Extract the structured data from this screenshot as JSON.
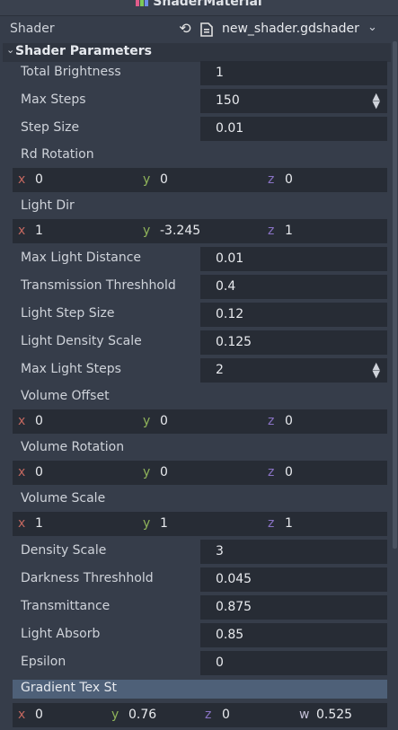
{
  "header": {
    "title": "ShaderMaterial"
  },
  "shader": {
    "label": "Shader",
    "file": "new_shader.gdshader"
  },
  "section": {
    "title": "Shader Parameters"
  },
  "params": {
    "total_brightness": {
      "label": "Total Brightness",
      "value": "1"
    },
    "max_steps": {
      "label": "Max Steps",
      "value": "150"
    },
    "step_size": {
      "label": "Step Size",
      "value": "0.01"
    },
    "rd_rotation": {
      "label": "Rd Rotation",
      "x": "0",
      "y": "0",
      "z": "0"
    },
    "light_dir": {
      "label": "Light Dir",
      "x": "1",
      "y": "-3.245",
      "z": "1"
    },
    "max_light_distance": {
      "label": "Max Light Distance",
      "value": "0.01"
    },
    "transmission_threshhold": {
      "label": "Transmission Threshhold",
      "value": "0.4"
    },
    "light_step_size": {
      "label": "Light Step Size",
      "value": "0.12"
    },
    "light_density_scale": {
      "label": "Light Density Scale",
      "value": "0.125"
    },
    "max_light_steps": {
      "label": "Max Light Steps",
      "value": "2"
    },
    "volume_offset": {
      "label": "Volume Offset",
      "x": "0",
      "y": "0",
      "z": "0"
    },
    "volume_rotation": {
      "label": "Volume Rotation",
      "x": "0",
      "y": "0",
      "z": "0"
    },
    "volume_scale": {
      "label": "Volume Scale",
      "x": "1",
      "y": "1",
      "z": "1"
    },
    "density_scale": {
      "label": "Density Scale",
      "value": "3"
    },
    "darkness_threshhold": {
      "label": "Darkness Threshhold",
      "value": "0.045"
    },
    "transmittance": {
      "label": "Transmittance",
      "value": "0.875"
    },
    "light_absorb": {
      "label": "Light Absorb",
      "value": "0.85"
    },
    "epsilon": {
      "label": "Epsilon",
      "value": "0"
    },
    "gradient_tex_st": {
      "label": "Gradient Tex St",
      "x": "0",
      "y": "0.76",
      "z": "0",
      "w": "0.525"
    }
  },
  "axes": {
    "x": "x",
    "y": "y",
    "z": "z",
    "w": "w"
  },
  "icons": {
    "reset": "reload-icon",
    "file": "shader-file-icon",
    "dropdown": "chevron-down-icon",
    "spin": "spinner-arrows-icon",
    "section": "collapse-arrow-icon"
  },
  "colors": {
    "axis_x": "#c2675f",
    "axis_y": "#8fb35a",
    "axis_z": "#8a73c6",
    "highlight": "#4e6078"
  }
}
